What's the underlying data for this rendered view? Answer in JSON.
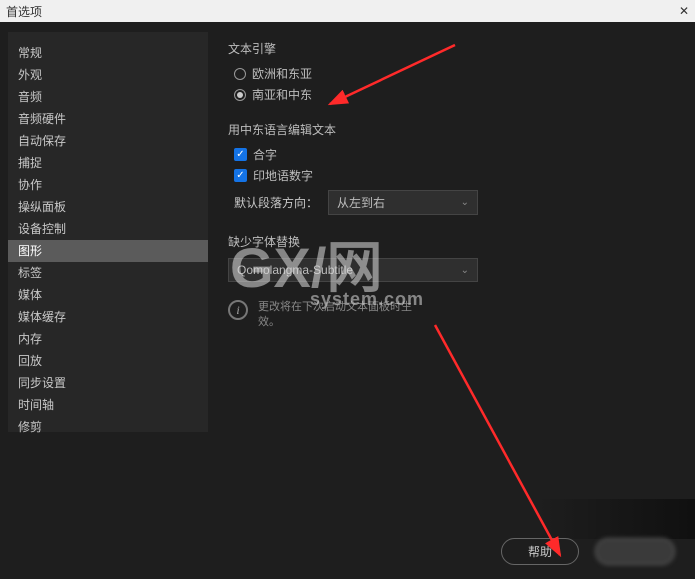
{
  "window": {
    "title": "首选项",
    "close": "✕"
  },
  "sidebar": {
    "items": [
      {
        "label": "常规"
      },
      {
        "label": "外观"
      },
      {
        "label": "音频"
      },
      {
        "label": "音频硬件"
      },
      {
        "label": "自动保存"
      },
      {
        "label": "捕捉"
      },
      {
        "label": "协作"
      },
      {
        "label": "操纵面板"
      },
      {
        "label": "设备控制"
      },
      {
        "label": "图形"
      },
      {
        "label": "标签"
      },
      {
        "label": "媒体"
      },
      {
        "label": "媒体缓存"
      },
      {
        "label": "内存"
      },
      {
        "label": "回放"
      },
      {
        "label": "同步设置"
      },
      {
        "label": "时间轴"
      },
      {
        "label": "修剪"
      }
    ],
    "activeIndex": 9
  },
  "content": {
    "textEngine": {
      "title": "文本引擎",
      "opt1": "欧洲和东亚",
      "opt2": "南亚和中东",
      "selectedIndex": 1
    },
    "meEditing": {
      "title": "用中东语言编辑文本",
      "ligature": "合字",
      "hindiDigits": "印地语数字",
      "paraDirLabel": "默认段落方向：",
      "paraDirValue": "从左到右"
    },
    "fontFallback": {
      "title": "缺少字体替换",
      "value": "Qomolangma-Subtitle"
    },
    "info": {
      "line1": "更改将在下次启动文本面板时生",
      "line2": "效。"
    }
  },
  "footer": {
    "help": "帮助"
  },
  "watermark": {
    "main": "GX/网",
    "sub": "system.com"
  }
}
